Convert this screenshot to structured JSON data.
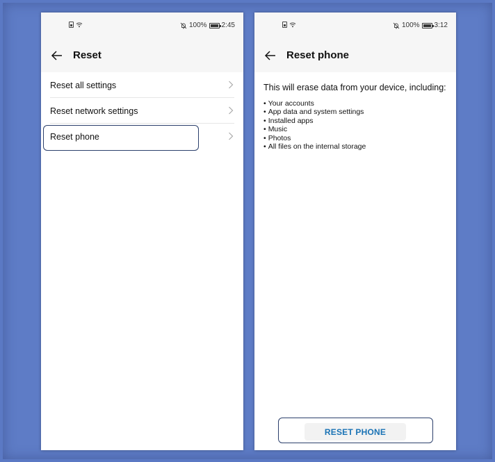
{
  "left_screen": {
    "status": {
      "battery": "100%",
      "time": "2:45"
    },
    "title": "Reset",
    "items": [
      {
        "label": "Reset all settings"
      },
      {
        "label": "Reset network settings"
      },
      {
        "label": "Reset phone"
      }
    ]
  },
  "right_screen": {
    "status": {
      "battery": "100%",
      "time": "3:12"
    },
    "title": "Reset phone",
    "intro": "This will erase data from your device, including:",
    "bullets": [
      "Your accounts",
      "App data and system settings",
      "Installed apps",
      "Music",
      "Photos",
      "All files on the internal storage"
    ],
    "button_label": "RESET PHONE"
  },
  "icons": {
    "status_left": [
      "sim-icon",
      "wifi-icon"
    ],
    "status_right": [
      "mute-icon",
      "battery-icon"
    ],
    "nav": [
      "back-arrow-icon",
      "chevron-right-icon"
    ]
  },
  "colors": {
    "background": "#5b79c4",
    "highlight_border": "#2b3f6b",
    "button_text": "#1a73b5",
    "button_bg": "#f2f2f2"
  }
}
